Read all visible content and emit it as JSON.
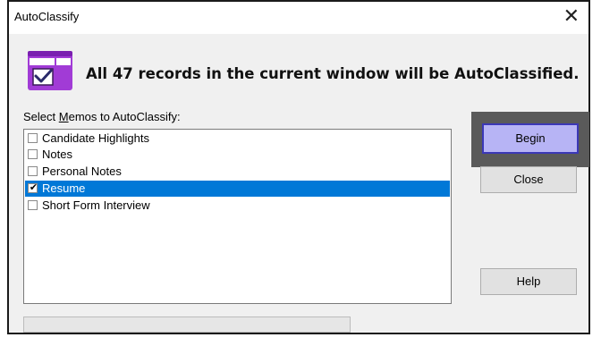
{
  "window": {
    "title": "AutoClassify",
    "close_glyph": "✕"
  },
  "header": {
    "icon": "checkbox-window-icon",
    "message": "All 47 records in the current window will be AutoClassified."
  },
  "list": {
    "label_prefix": "Select ",
    "label_accel": "M",
    "label_suffix": "emos to AutoClassify:",
    "items": [
      {
        "label": "Candidate Highlights",
        "checked": false,
        "selected": false
      },
      {
        "label": "Notes",
        "checked": false,
        "selected": false
      },
      {
        "label": "Personal Notes",
        "checked": false,
        "selected": false
      },
      {
        "label": "Resume",
        "checked": true,
        "selected": true
      },
      {
        "label": "Short Form Interview",
        "checked": false,
        "selected": false
      }
    ]
  },
  "buttons": {
    "begin": "Begin",
    "close": "Close",
    "help": "Help"
  },
  "progress": {
    "value": 0
  },
  "colors": {
    "accent_purple": "#a13bd6",
    "selection": "#0078d7",
    "begin_fill": "#b7b4f5",
    "begin_border": "#3b38b7"
  }
}
